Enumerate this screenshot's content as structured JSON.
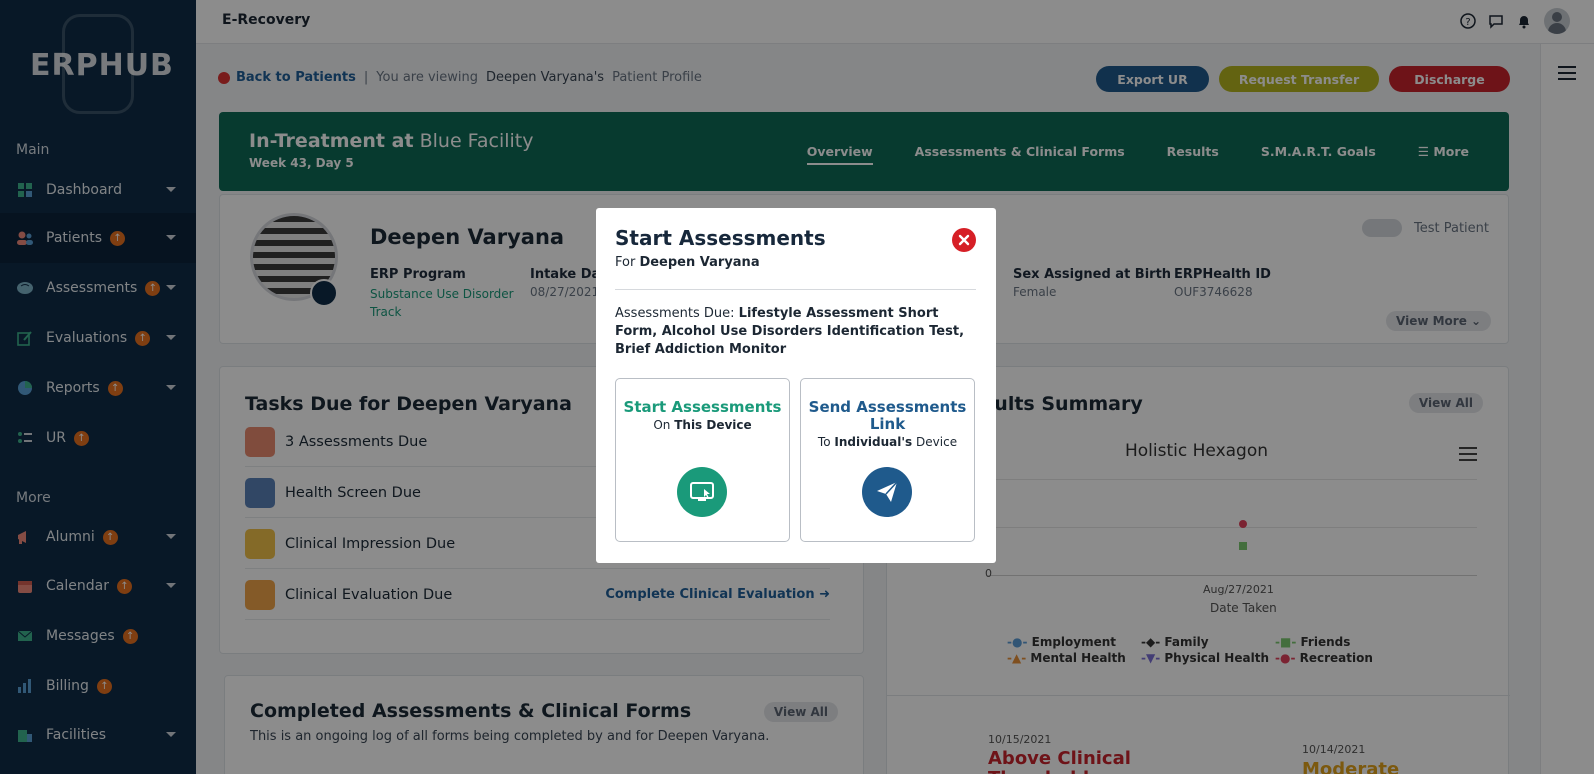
{
  "app": {
    "title": "E-Recovery",
    "logo_text": "ERPHUB"
  },
  "sidebar": {
    "section_main": "Main",
    "section_more": "More",
    "items_main": [
      {
        "label": "Dashboard",
        "badge": false,
        "caret": true
      },
      {
        "label": "Patients",
        "badge": true,
        "caret": true
      },
      {
        "label": "Assessments",
        "badge": true,
        "caret": true
      },
      {
        "label": "Evaluations",
        "badge": true,
        "caret": true
      },
      {
        "label": "Reports",
        "badge": true,
        "caret": true
      },
      {
        "label": "UR",
        "badge": true,
        "caret": false
      }
    ],
    "items_more": [
      {
        "label": "Alumni",
        "badge": true,
        "caret": true
      },
      {
        "label": "Calendar",
        "badge": true,
        "caret": true
      },
      {
        "label": "Messages",
        "badge": true,
        "caret": false
      },
      {
        "label": "Billing",
        "badge": true,
        "caret": false
      },
      {
        "label": "Facilities",
        "badge": false,
        "caret": true
      }
    ]
  },
  "breadcrumb": {
    "back_label": "Back to Patients",
    "separator": "|",
    "viewing_prefix": "You are viewing",
    "viewing_name": "Deepen Varyana's",
    "viewing_suffix": "Patient Profile"
  },
  "actions": {
    "export": "Export UR",
    "transfer": "Request Transfer",
    "discharge": "Discharge",
    "colors": {
      "export": "#1f5a8c",
      "transfer": "#b4b51f",
      "discharge": "#c9232d"
    }
  },
  "banner": {
    "status": "In-Treatment at",
    "facility": "Blue Facility",
    "week": "Week 43, Day 5",
    "tabs": [
      "Overview",
      "Assessments & Clinical Forms",
      "Results",
      "S.M.A.R.T. Goals",
      "More"
    ]
  },
  "profile": {
    "name": "Deepen Varyana",
    "program_label": "ERP Program",
    "program_value": "Substance Use Disorder Track",
    "intake_label": "Intake Dat",
    "intake_value": "08/27/2021",
    "sex_label": "Sex Assigned at Birth",
    "sex_value": "Female",
    "id_label": "ERPHealth ID",
    "id_value": "OUF3746628",
    "test_patient": "Test Patient",
    "view_more": "View More"
  },
  "tasks": {
    "title": "Tasks Due for Deepen Varyana",
    "rows": [
      {
        "label": "3 Assessments Due",
        "link": ""
      },
      {
        "label": "Health Screen Due",
        "link": ""
      },
      {
        "label": "Clinical Impression Due",
        "link": ""
      },
      {
        "label": "Clinical Evaluation Due",
        "link": "Complete Clinical Evaluation"
      }
    ]
  },
  "completed": {
    "title": "Completed Assessments & Clinical Forms",
    "subtitle": "This is an ongoing log of all forms being completed by and for Deepen Varyana.",
    "view_all": "View All"
  },
  "results": {
    "title": "sults Summary",
    "view_all": "View All",
    "chart_title": "Holistic Hexagon",
    "zero_label": "0",
    "x_tick": "Aug/27/2021",
    "x_label": "Date Taken",
    "legend": [
      "Employment",
      "Family",
      "Friends",
      "Mental Health",
      "Physical Health",
      "Recreation"
    ],
    "legend_colors": [
      "#5a9bd5",
      "#333333",
      "#7bc96f",
      "#e8913a",
      "#7b6fd6",
      "#e0405b"
    ],
    "entries": [
      {
        "date": "10/15/2021",
        "status": "Above Clinical Threshold",
        "color": "#c9232d"
      },
      {
        "date": "10/14/2021",
        "status": "Moderate",
        "color": "#e2a21b"
      }
    ]
  },
  "modal": {
    "title": "Start Assessments",
    "for_prefix": "For",
    "for_name": "Deepen Varyana",
    "due_prefix": "Assessments Due:",
    "due_list": "Lifestyle Assessment Short Form, Alcohol Use Disorders Identification Test, Brief Addiction Monitor",
    "option_device": {
      "title": "Start Assessments",
      "sub_prefix": "On",
      "sub_bold": "This Device",
      "color": "#1a9a7a"
    },
    "option_link": {
      "title": "Send Assessments Link",
      "sub_prefix": "To",
      "sub_bold": "Individual's",
      "sub_suffix": "Device",
      "color": "#1f5a8c"
    }
  }
}
